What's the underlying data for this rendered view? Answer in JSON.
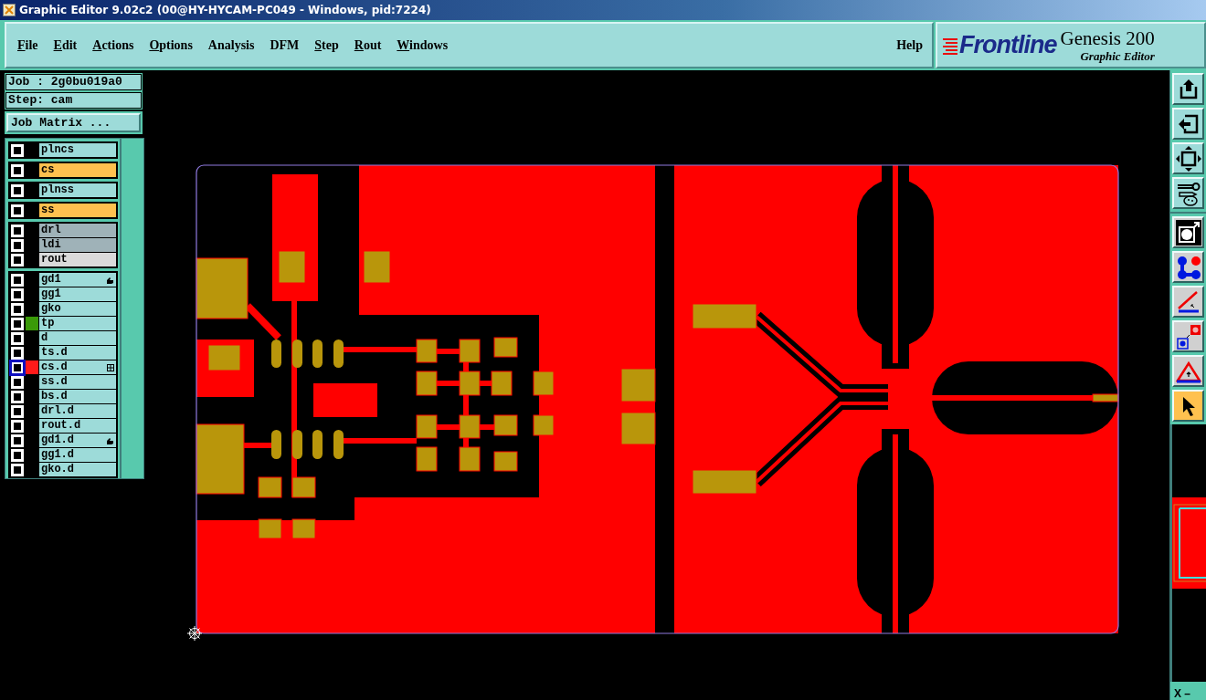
{
  "window": {
    "title": "Graphic Editor 9.02c2 (00@HY-HYCAM-PC049 - Windows, pid:7224)"
  },
  "menu": [
    {
      "label": "File",
      "mnemonic": true
    },
    {
      "label": "Edit",
      "mnemonic": true
    },
    {
      "label": "Actions",
      "mnemonic": true
    },
    {
      "label": "Options",
      "mnemonic": true
    },
    {
      "label": "Analysis",
      "mnemonic": false
    },
    {
      "label": "DFM",
      "mnemonic": false
    },
    {
      "label": "Step",
      "mnemonic": true
    },
    {
      "label": "Rout",
      "mnemonic": true
    },
    {
      "label": "Windows",
      "mnemonic": true
    }
  ],
  "help": {
    "label": "Help"
  },
  "branding": {
    "logo": "Frontline",
    "product": "Genesis 200",
    "subtitle": "Graphic Editor"
  },
  "job_info": {
    "job": "Job : 2g0bu019a0",
    "step": "Step: cam"
  },
  "job_matrix_button": {
    "label": "Job Matrix ..."
  },
  "layer_groups": [
    {
      "layers": [
        {
          "name": "plncs",
          "kind": "plane",
          "selected": false
        }
      ]
    },
    {
      "layers": [
        {
          "name": "cs",
          "kind": "signal",
          "selected": false
        }
      ]
    },
    {
      "layers": [
        {
          "name": "plnss",
          "kind": "plane",
          "selected": false
        }
      ]
    },
    {
      "layers": [
        {
          "name": "ss",
          "kind": "signal",
          "selected": false
        }
      ]
    },
    {
      "layers": [
        {
          "name": "drl",
          "kind": "drill",
          "selected": false
        },
        {
          "name": "ldi",
          "kind": "drill",
          "selected": false
        },
        {
          "name": "rout",
          "kind": "rout",
          "selected": false
        }
      ]
    },
    {
      "layers": [
        {
          "name": "gd1",
          "kind": "misc",
          "selected": false,
          "hand_mark": true,
          "grid_mark": false
        },
        {
          "name": "gg1",
          "kind": "misc",
          "selected": false,
          "hand_mark": false,
          "grid_mark": false
        },
        {
          "name": "gko",
          "kind": "misc",
          "selected": false,
          "hand_mark": false,
          "grid_mark": false
        },
        {
          "name": "tp",
          "kind": "misc",
          "selected": false,
          "hand_mark": false,
          "grid_mark": false,
          "color": "#3a9a08"
        },
        {
          "name": "d",
          "kind": "misc",
          "selected": false,
          "hand_mark": false,
          "grid_mark": false
        },
        {
          "name": "ts.d",
          "kind": "misc",
          "selected": false,
          "hand_mark": false,
          "grid_mark": false
        },
        {
          "name": "cs.d",
          "kind": "misc",
          "selected": true,
          "hand_mark": false,
          "grid_mark": true,
          "color": "#ff1a1a"
        },
        {
          "name": "ss.d",
          "kind": "misc",
          "selected": false,
          "hand_mark": false,
          "grid_mark": false
        },
        {
          "name": "bs.d",
          "kind": "misc",
          "selected": false,
          "hand_mark": false,
          "grid_mark": false
        },
        {
          "name": "drl.d",
          "kind": "misc",
          "selected": false,
          "hand_mark": false,
          "grid_mark": false
        },
        {
          "name": "rout.d",
          "kind": "misc",
          "selected": false,
          "hand_mark": false,
          "grid_mark": false
        },
        {
          "name": "gd1.d",
          "kind": "misc",
          "selected": false,
          "hand_mark": true,
          "grid_mark": false
        },
        {
          "name": "gg1.d",
          "kind": "misc",
          "selected": false,
          "hand_mark": false,
          "grid_mark": false
        },
        {
          "name": "gko.d",
          "kind": "misc",
          "selected": false,
          "hand_mark": false,
          "grid_mark": false
        }
      ]
    }
  ],
  "tool_groups": [
    {
      "tools": [
        {
          "kind": "export",
          "selected": false
        },
        {
          "kind": "import",
          "selected": false
        },
        {
          "kind": "fit",
          "selected": false
        },
        {
          "kind": "tools",
          "selected": false
        }
      ]
    },
    {
      "tools": [
        {
          "kind": "display",
          "selected": false
        },
        {
          "kind": "snap",
          "selected": false
        },
        {
          "kind": "measure",
          "selected": false
        },
        {
          "kind": "transform",
          "selected": false
        },
        {
          "kind": "triangle",
          "selected": false
        },
        {
          "kind": "pointer",
          "selected": true
        }
      ]
    }
  ],
  "coordinate_bar": {
    "label": "X –"
  }
}
